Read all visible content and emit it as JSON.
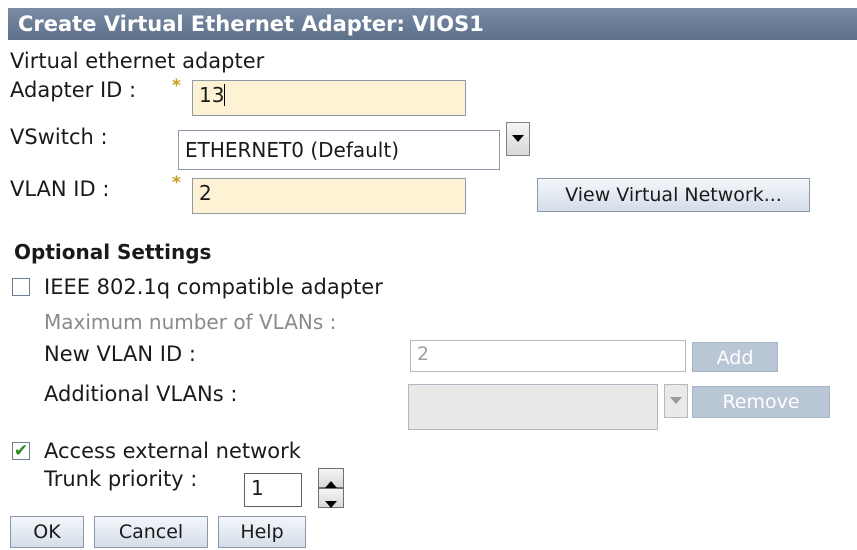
{
  "title": "Create Virtual Ethernet Adapter: VIOS1",
  "section_label": "Virtual ethernet adapter",
  "adapter_id": {
    "label": "Adapter ID :",
    "required_mark": "*",
    "value": "13"
  },
  "vswitch": {
    "label": "VSwitch :",
    "selected": "ETHERNET0 (Default)"
  },
  "vlan_id": {
    "label": "VLAN ID :",
    "required_mark": "*",
    "value": "2"
  },
  "view_network_button": "View Virtual Network...",
  "optional": {
    "heading": "Optional Settings",
    "ieee_checkbox": {
      "label": "IEEE 802.1q compatible adapter",
      "checked": false
    },
    "max_vlans_label": "Maximum number of VLANs :",
    "new_vlan_id": {
      "label": "New VLAN ID :",
      "value": "2"
    },
    "add_button": "Add",
    "additional_vlans": {
      "label": "Additional VLANs :"
    },
    "remove_button": "Remove",
    "access_external": {
      "label": "Access external network",
      "checked": true
    },
    "trunk_priority": {
      "label": "Trunk priority :",
      "value": "1"
    }
  },
  "buttons": {
    "ok": "OK",
    "cancel": "Cancel",
    "help": "Help"
  },
  "colors": {
    "title_bar": "#6b7d95",
    "required_field_bg": "#fdf3d4",
    "disabled_button": "#b9c6d6",
    "required_mark": "#c89a1a"
  }
}
